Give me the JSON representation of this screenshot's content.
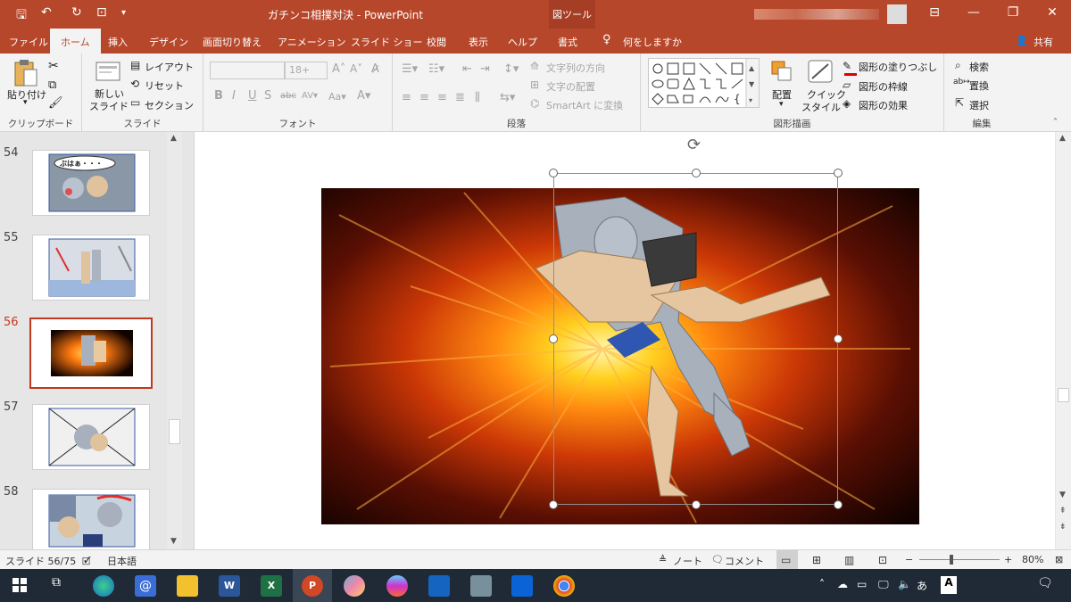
{
  "window": {
    "title": "ガチンコ相撲対決 - PowerPoint",
    "context_tab_group": "図ツール"
  },
  "tabs": [
    "ファイル",
    "ホーム",
    "挿入",
    "デザイン",
    "画面切り替え",
    "アニメーション",
    "スライド ショー",
    "校閲",
    "表示",
    "ヘルプ",
    "書式"
  ],
  "tell_me": "何をしますか",
  "share": "共有",
  "ribbon": {
    "clipboard": {
      "paste": "貼り付け",
      "label": "クリップボード"
    },
    "slides": {
      "new_slide_line1": "新しい",
      "new_slide_line2": "スライド",
      "layout": "レイアウト",
      "reset": "リセット",
      "section": "セクション",
      "label": "スライド"
    },
    "font": {
      "size": "18+",
      "label": "フォント"
    },
    "paragraph": {
      "text_direction": "文字列の方向",
      "align_text": "文字の配置",
      "smartart": "SmartArt に変換",
      "label": "段落"
    },
    "drawing": {
      "arrange": "配置",
      "quick_style_line1": "クイック",
      "quick_style_line2": "スタイル",
      "shape_fill": "図形の塗りつぶし",
      "shape_outline": "図形の枠線",
      "shape_effects": "図形の効果",
      "label": "図形描画"
    },
    "editing": {
      "find": "検索",
      "replace": "置換",
      "select": "選択",
      "label": "編集"
    }
  },
  "slides_panel": {
    "slides": [
      {
        "number": "54",
        "bubble": "ぶはぁ・・・"
      },
      {
        "number": "55"
      },
      {
        "number": "56",
        "selected": true
      },
      {
        "number": "57"
      },
      {
        "number": "58"
      }
    ]
  },
  "status": {
    "slide_info": "スライド 56/75",
    "language": "日本語",
    "notes": "ノート",
    "comments": "コメント",
    "zoom": "80%",
    "zoom_minus": "−",
    "zoom_plus": "+"
  },
  "colors": {
    "accent": "#b7472a",
    "selected": "#c4391d"
  },
  "taskbar": {
    "ime": "あ"
  }
}
